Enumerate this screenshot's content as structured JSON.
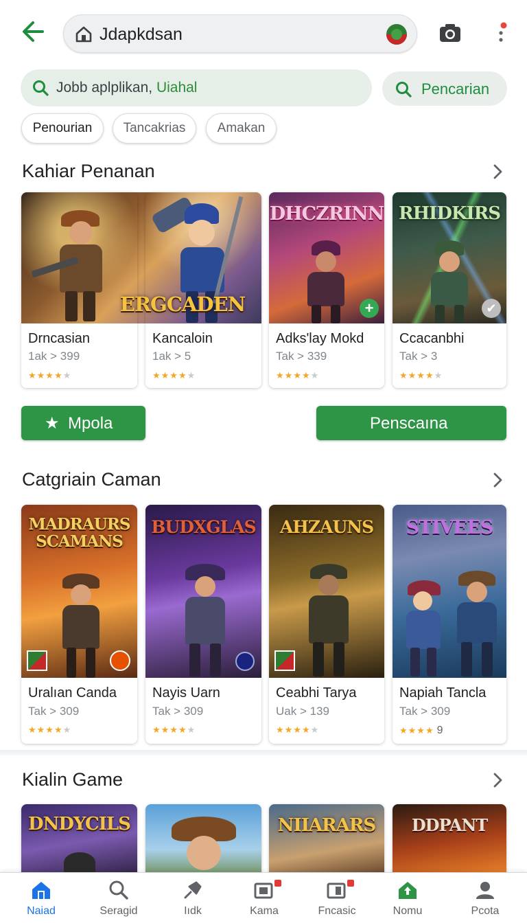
{
  "topbar": {
    "url": "Jdapkdsan"
  },
  "search": {
    "query_prefix": "Jobb aplplikan, ",
    "query_highlight": "Uiahal",
    "button_label": "Pencarian"
  },
  "chips": [
    "Penourian",
    "Tancakrias",
    "Amakan"
  ],
  "section1": {
    "title": "Kahiar Penanan",
    "hero_art_title": "ERGCADEN",
    "art_titles": [
      "DHCZRINN",
      "RHIDKIRS"
    ],
    "cards": [
      {
        "name": "Drncasian",
        "meta": "1ak > 399",
        "rating": 4
      },
      {
        "name": "Kancaloin",
        "meta": "1ak > 5",
        "rating": 4
      },
      {
        "name": "Adks'lay Mokd",
        "meta": "Tak > 339",
        "rating": 4
      },
      {
        "name": "Ccacanbhi",
        "meta": "Tak > 3",
        "rating": 4
      }
    ]
  },
  "actions": {
    "left_label": "Mpola",
    "right_label": "Penscaına"
  },
  "section2": {
    "title": "Catgriain Caman",
    "art_titles": [
      "MADRAURS SCAMANS",
      "BUDXGLAS",
      "AHZAUNS",
      "STIVEES"
    ],
    "cards": [
      {
        "name": "Uralıan Canda",
        "meta": "Tak > 309",
        "rating": 4,
        "count": ""
      },
      {
        "name": "Nayis Uarn",
        "meta": "Tak > 309",
        "rating": 4,
        "count": ""
      },
      {
        "name": "Ceabhi Tarya",
        "meta": "Uak > 139",
        "rating": 4,
        "count": ""
      },
      {
        "name": "Napiah Tancla",
        "meta": "Tak > 309",
        "rating": 4,
        "count": "9"
      }
    ]
  },
  "section3": {
    "title": "Kialin Game",
    "art_titles": [
      "DNDYCILS",
      "",
      "NIIARARS",
      "DDPANT"
    ]
  },
  "bottomnav": [
    {
      "label": "Naiad",
      "icon": "home-icon",
      "active": true
    },
    {
      "label": "Seragid",
      "icon": "search-icon",
      "active": false
    },
    {
      "label": "Iıdk",
      "icon": "pin-icon",
      "active": false
    },
    {
      "label": "Kama",
      "icon": "media-icon",
      "active": false
    },
    {
      "label": "Fncasic",
      "icon": "library-icon",
      "active": false
    },
    {
      "label": "Nomu",
      "icon": "store-icon",
      "active": false
    },
    {
      "label": "Pcota",
      "icon": "person-icon",
      "active": false
    }
  ],
  "colors": {
    "accent_green": "#2e9446",
    "link_blue": "#1a73e8",
    "star": "#f5a623"
  }
}
